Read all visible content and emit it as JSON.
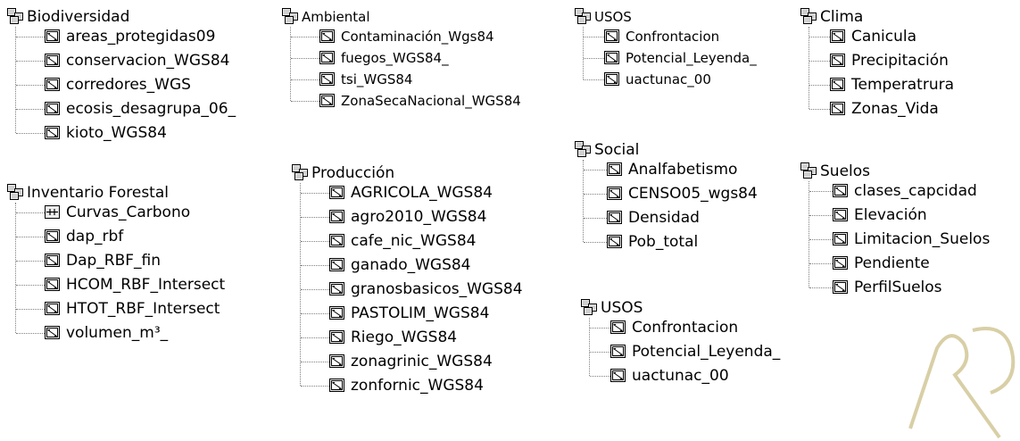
{
  "groups": [
    {
      "id": "biodiversidad",
      "title": "Biodiversidad",
      "layers": [
        {
          "name": "areas_protegidas09",
          "icon": "polygon-layer-icon"
        },
        {
          "name": "conservacion_WGS84",
          "icon": "polygon-layer-icon"
        },
        {
          "name": "corredores_WGS",
          "icon": "polygon-layer-icon"
        },
        {
          "name": "ecosis_desagrupa_06_",
          "icon": "polygon-layer-icon"
        },
        {
          "name": "kioto_WGS84",
          "icon": "polygon-layer-icon"
        }
      ]
    },
    {
      "id": "inventario-forestal",
      "title": "Inventario Forestal",
      "layers": [
        {
          "name": "Curvas_Carbono",
          "icon": "line-layer-icon"
        },
        {
          "name": "dap_rbf",
          "icon": "polygon-layer-icon"
        },
        {
          "name": "Dap_RBF_fin",
          "icon": "polygon-layer-icon"
        },
        {
          "name": "HCOM_RBF_Intersect",
          "icon": "polygon-layer-icon"
        },
        {
          "name": "HTOT_RBF_Intersect",
          "icon": "polygon-layer-icon"
        },
        {
          "name": "volumen_m³_",
          "icon": "polygon-layer-icon"
        }
      ]
    },
    {
      "id": "ambiental",
      "title": "Ambiental",
      "layers": [
        {
          "name": "Contaminación_Wgs84",
          "icon": "polygon-layer-icon"
        },
        {
          "name": "fuegos_WGS84_",
          "icon": "polygon-layer-icon"
        },
        {
          "name": "tsi_WGS84",
          "icon": "polygon-layer-icon"
        },
        {
          "name": "ZonaSecaNacional_WGS84",
          "icon": "polygon-layer-icon"
        }
      ]
    },
    {
      "id": "produccion",
      "title": "Producción",
      "layers": [
        {
          "name": "AGRICOLA_WGS84",
          "icon": "polygon-layer-icon"
        },
        {
          "name": "agro2010_WGS84",
          "icon": "polygon-layer-icon"
        },
        {
          "name": "cafe_nic_WGS84",
          "icon": "polygon-layer-icon"
        },
        {
          "name": "ganado_WGS84",
          "icon": "polygon-layer-icon"
        },
        {
          "name": "granosbasicos_WGS84",
          "icon": "polygon-layer-icon"
        },
        {
          "name": "PASTOLIM_WGS84",
          "icon": "polygon-layer-icon"
        },
        {
          "name": "Riego_WGS84",
          "icon": "polygon-layer-icon"
        },
        {
          "name": "zonagrinic_WGS84",
          "icon": "polygon-layer-icon"
        },
        {
          "name": "zonfornic_WGS84",
          "icon": "polygon-layer-icon"
        }
      ]
    },
    {
      "id": "usos-1",
      "title": "USOS",
      "layers": [
        {
          "name": "Confrontacion",
          "icon": "polygon-layer-icon"
        },
        {
          "name": "Potencial_Leyenda_",
          "icon": "polygon-layer-icon"
        },
        {
          "name": "uactunac_00",
          "icon": "polygon-layer-icon"
        }
      ]
    },
    {
      "id": "social",
      "title": "Social",
      "layers": [
        {
          "name": "Analfabetismo",
          "icon": "polygon-layer-icon"
        },
        {
          "name": "CENSO05_wgs84",
          "icon": "polygon-layer-icon"
        },
        {
          "name": "Densidad",
          "icon": "polygon-layer-icon"
        },
        {
          "name": "Pob_total",
          "icon": "polygon-layer-icon"
        }
      ]
    },
    {
      "id": "usos-2",
      "title": "USOS",
      "layers": [
        {
          "name": "Confrontacion",
          "icon": "polygon-layer-icon"
        },
        {
          "name": "Potencial_Leyenda_",
          "icon": "polygon-layer-icon"
        },
        {
          "name": "uactunac_00",
          "icon": "polygon-layer-icon"
        }
      ]
    },
    {
      "id": "clima",
      "title": "Clima",
      "layers": [
        {
          "name": "Canicula",
          "icon": "polygon-layer-icon"
        },
        {
          "name": "Precipitación",
          "icon": "polygon-layer-icon"
        },
        {
          "name": "Temperatrura",
          "icon": "polygon-layer-icon"
        },
        {
          "name": "Zonas_Vida",
          "icon": "polygon-layer-icon"
        }
      ]
    },
    {
      "id": "suelos",
      "title": "Suelos",
      "layers": [
        {
          "name": "clases_capcidad",
          "icon": "polygon-layer-icon"
        },
        {
          "name": "Elevación",
          "icon": "polygon-layer-icon"
        },
        {
          "name": "Limitacion_Suelos",
          "icon": "polygon-layer-icon"
        },
        {
          "name": "Pendiente",
          "icon": "polygon-layer-icon"
        },
        {
          "name": "PerfilSuelos",
          "icon": "polygon-layer-icon"
        }
      ]
    }
  ],
  "watermark": {
    "color": "#d8cfa6"
  }
}
